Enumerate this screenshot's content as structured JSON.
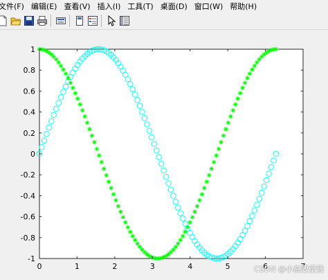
{
  "menu": [
    "文件(F)",
    "编辑(E)",
    "查看(V)",
    "插入(I)",
    "工具(T)",
    "桌面(D)",
    "窗口(W)",
    "帮助(H)"
  ],
  "toolbar_icons": [
    "new-file-icon",
    "open-folder-icon",
    "save-icon",
    "print-icon",
    "link-icon",
    "dock-icon",
    "insert-colorbar-icon",
    "pointer-icon",
    "property-editor-icon"
  ],
  "watermark": "CSDN @小高要坚强",
  "chart_data": {
    "type": "scatter",
    "xlim": [
      0,
      7
    ],
    "ylim": [
      -1,
      1
    ],
    "xticks": [
      "0",
      "1",
      "2",
      "3",
      "4",
      "5",
      "6",
      "7"
    ],
    "yticks": [
      "1",
      "0.8",
      "0.6",
      "0.4",
      "0.2",
      "0",
      "-0.2",
      "-0.4",
      "-0.6",
      "-0.8",
      "-1"
    ],
    "grid": false,
    "series": [
      {
        "function": "sin(x)",
        "marker": "circle",
        "color": "#00ffff",
        "x_start": 0,
        "x_end": 6.2832,
        "count": 100
      },
      {
        "function": "cos(x)",
        "marker": "asterisk",
        "color": "#00ff00",
        "x_start": 0,
        "x_end": 6.2832,
        "count": 100
      }
    ]
  }
}
